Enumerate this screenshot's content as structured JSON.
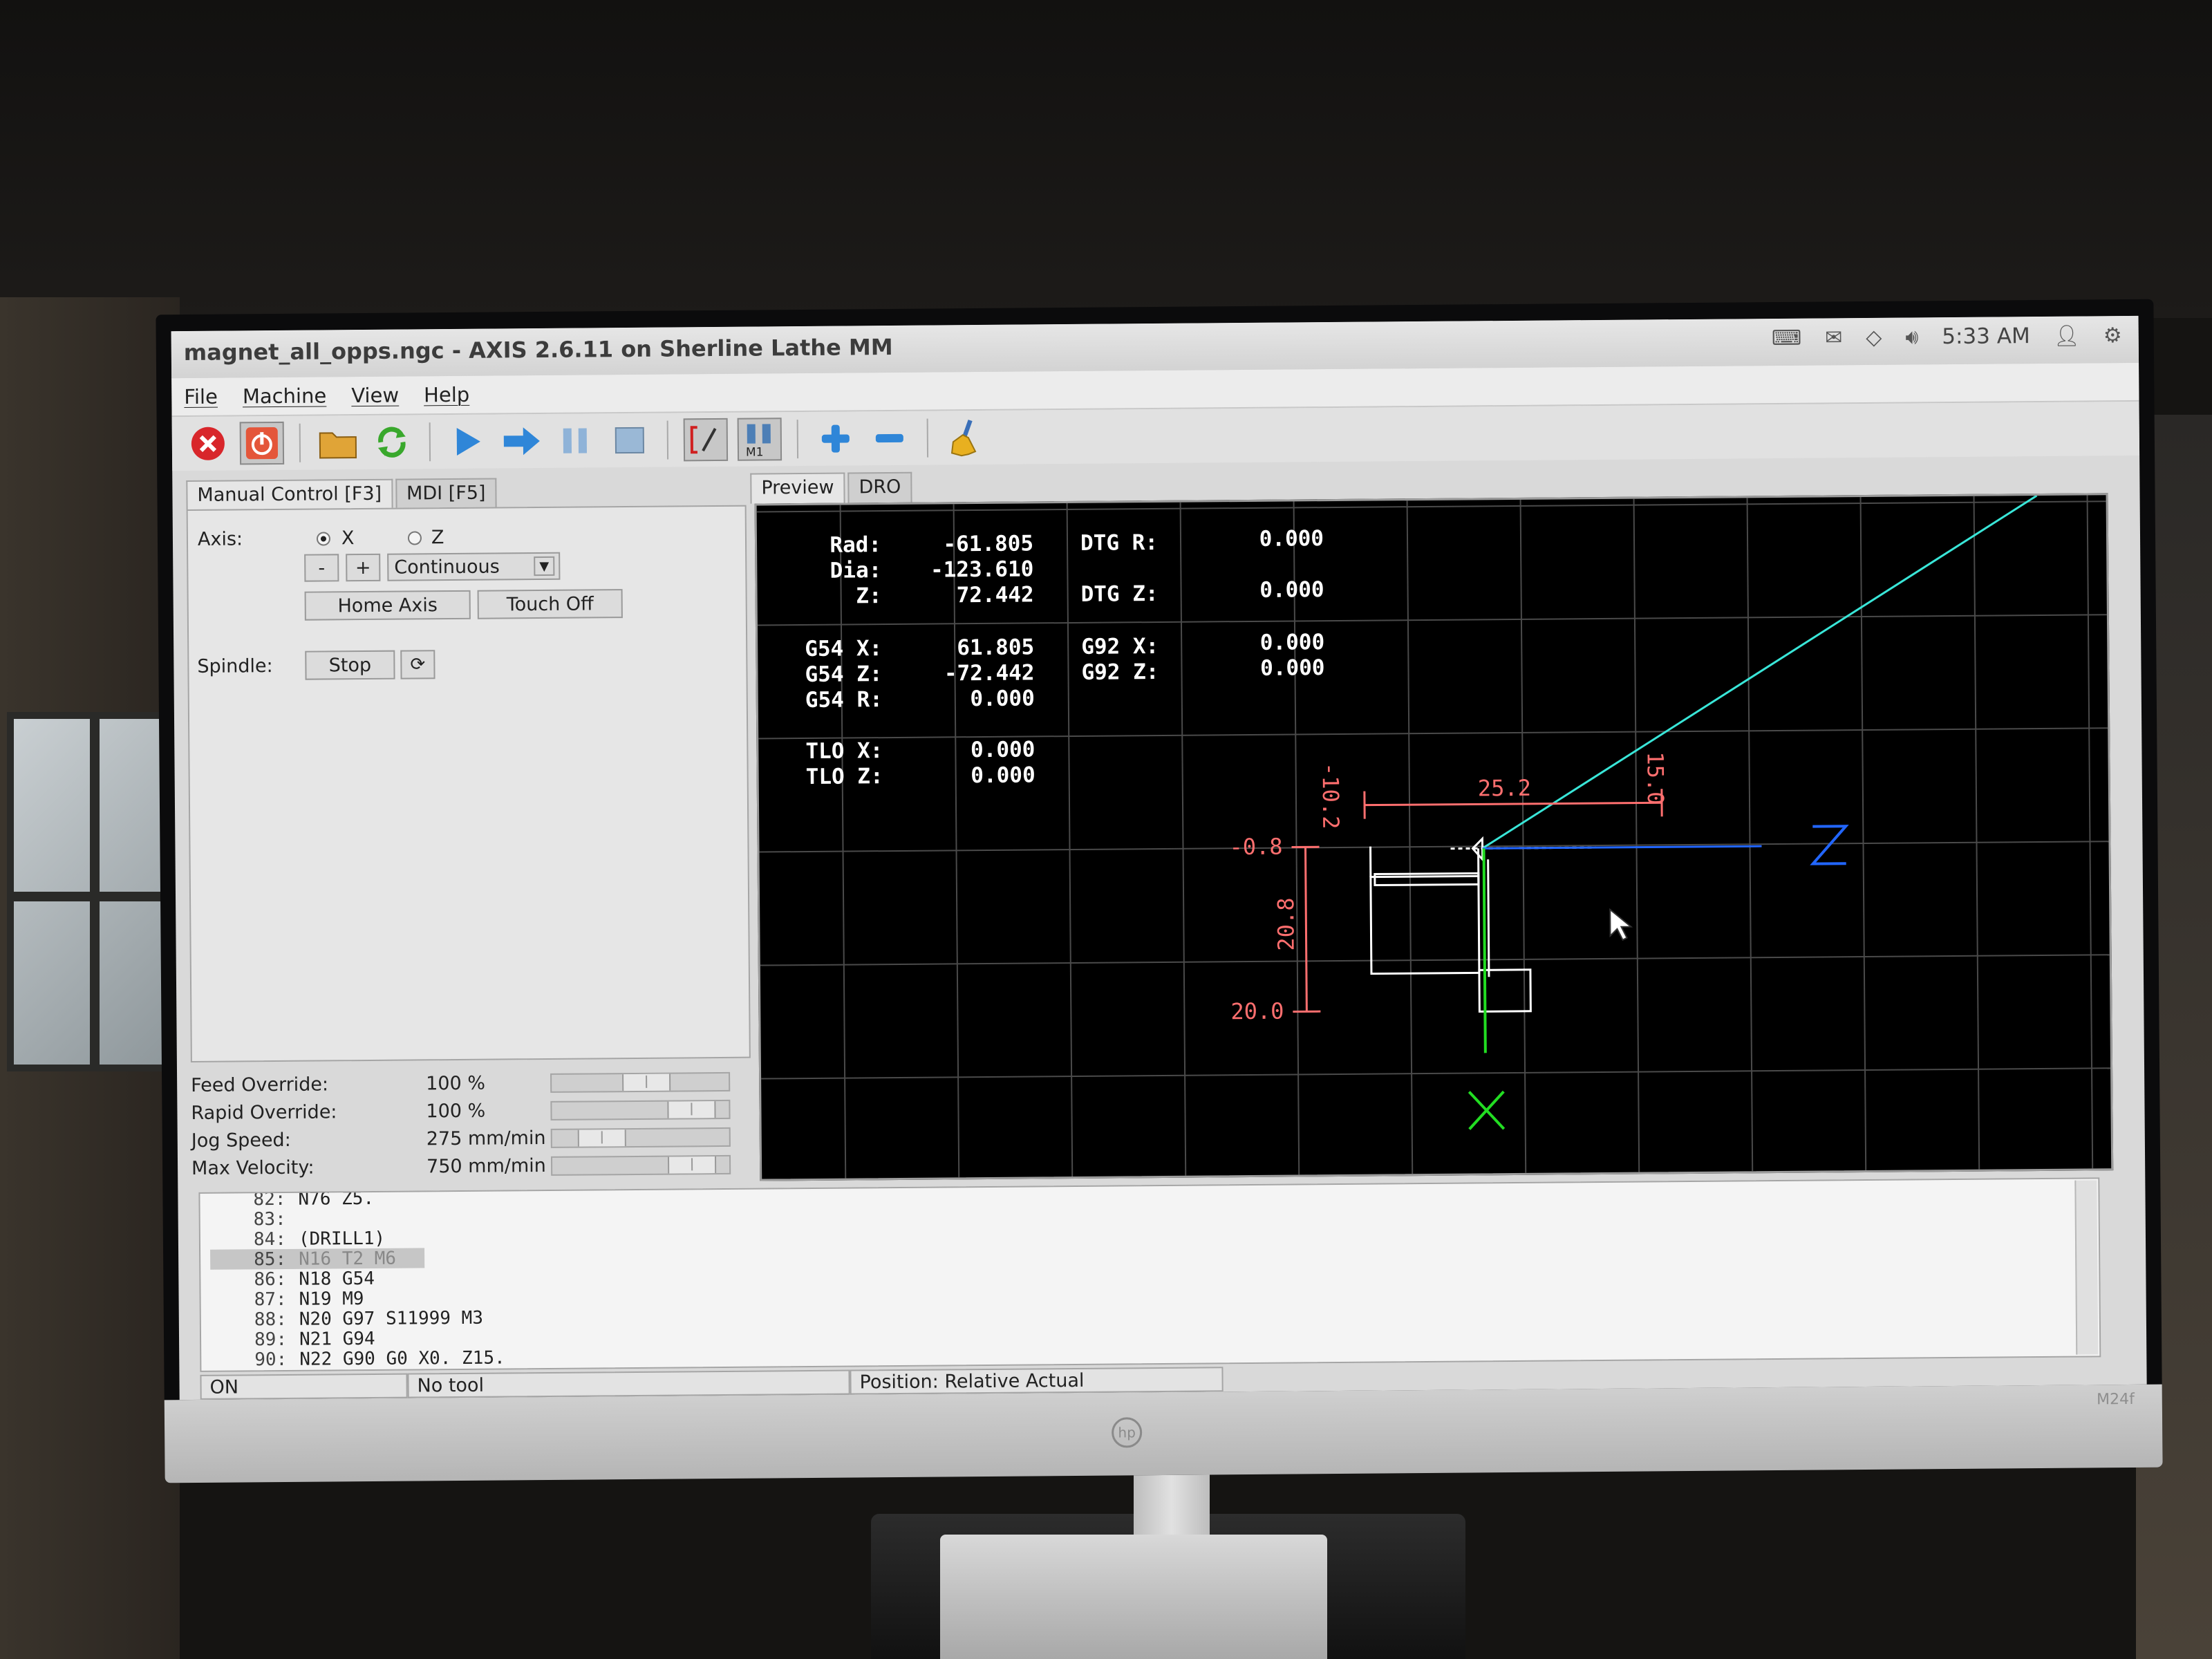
{
  "window": {
    "title": "magnet_all_opps.ngc - AXIS 2.6.11 on Sherline Lathe MM"
  },
  "system": {
    "time": "5:33 AM",
    "icons": [
      "keyboard-icon",
      "mail-icon",
      "wifi-icon",
      "volume-icon",
      "user-icon",
      "gear-icon"
    ]
  },
  "menu": [
    "File",
    "Machine",
    "View",
    "Help"
  ],
  "toolbar": {
    "icons": [
      "estop-icon",
      "power-icon",
      "open-file-icon",
      "reload-icon",
      "run-icon",
      "step-icon",
      "pause-icon",
      "stop-icon",
      "block-delete-icon",
      "optional-stop-icon",
      "zoom-in-icon",
      "zoom-out-icon",
      "clear-plot-icon"
    ]
  },
  "left_tabs": [
    "Manual Control [F3]",
    "MDI [F5]"
  ],
  "manual": {
    "axis_label": "Axis:",
    "axis_x": "X",
    "axis_z": "Z",
    "jog_minus": "-",
    "jog_plus": "+",
    "jog_mode": "Continuous",
    "home_axis": "Home Axis",
    "touch_off": "Touch Off",
    "spindle_label": "Spindle:",
    "spindle_stop": "Stop"
  },
  "sliders": [
    {
      "label": "Feed Override:",
      "value": "100 %",
      "position": 0.55
    },
    {
      "label": "Rapid Override:",
      "value": "100 %",
      "position": 0.9
    },
    {
      "label": "Jog Speed:",
      "value": "275 mm/min",
      "position": 0.2
    },
    {
      "label": "Max Velocity:",
      "value": "750 mm/min",
      "position": 0.9
    }
  ],
  "right_tabs": [
    "Preview",
    "DRO"
  ],
  "dro": {
    "rad_label": "Rad:",
    "rad": "-61.805",
    "dia_label": "Dia:",
    "dia": "-123.610",
    "z_label": "Z:",
    "z": "72.442",
    "dtg_r_label": "DTG R:",
    "dtg_r": "0.000",
    "dtg_z_label": "DTG Z:",
    "dtg_z": "0.000",
    "g54x_label": "G54 X:",
    "g54x": "61.805",
    "g54z_label": "G54 Z:",
    "g54z": "-72.442",
    "g54r_label": "G54 R:",
    "g54r": "0.000",
    "g92x_label": "G92 X:",
    "g92x": "0.000",
    "g92z_label": "G92 Z:",
    "g92z": "0.000",
    "tlox_label": "TLO X:",
    "tlox": "0.000",
    "tloz_label": "TLO Z:",
    "tloz": "0.000"
  },
  "dimensions": {
    "left_top": "-10.2",
    "width": "25.2",
    "right_top": "15.0",
    "x_top": "-0.8",
    "height": "20.8",
    "x_bottom": "20.0"
  },
  "axis_labels": {
    "z": "Z",
    "x": "X"
  },
  "gcode": [
    {
      "num": "82:",
      "text": "N76 Z5."
    },
    {
      "num": "83:",
      "text": ""
    },
    {
      "num": "84:",
      "text": "(DRILL1)"
    },
    {
      "num": "85:",
      "text": "N16 T2 M6",
      "selected": true
    },
    {
      "num": "86:",
      "text": "N18 G54"
    },
    {
      "num": "87:",
      "text": "N19 M9"
    },
    {
      "num": "88:",
      "text": "N20 G97 S11999 M3"
    },
    {
      "num": "89:",
      "text": "N21 G94"
    },
    {
      "num": "90:",
      "text": "N22 G90 G0 X0. Z15."
    }
  ],
  "status": {
    "state": "ON",
    "tool": "No tool",
    "position": "Position: Relative Actual"
  },
  "colors": {
    "path_rapid": "#39e6d8",
    "z_axis": "#2266ff",
    "x_axis": "#22dd22",
    "dim": "#ff6f6f"
  },
  "monitor": {
    "model": "M24f"
  }
}
